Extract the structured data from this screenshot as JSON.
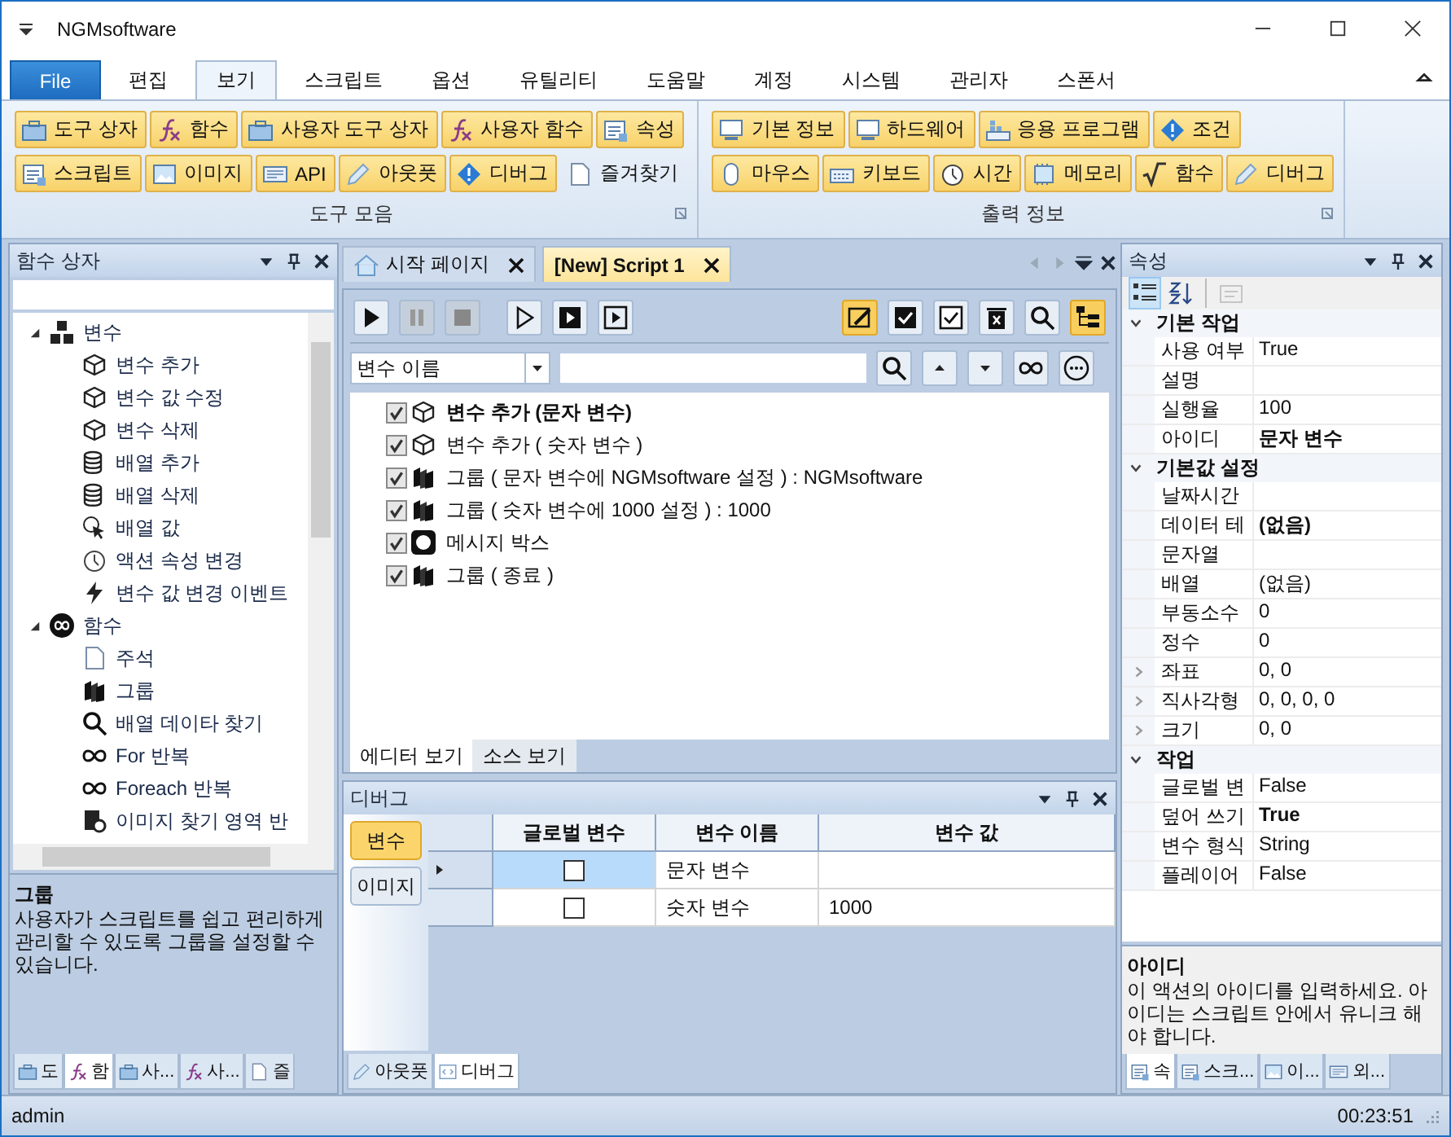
{
  "window": {
    "title": "NGMsoftware"
  },
  "file_button": "File",
  "menu_tabs": [
    {
      "label": "편집",
      "selected": false
    },
    {
      "label": "보기",
      "selected": true
    },
    {
      "label": "스크립트",
      "selected": false
    },
    {
      "label": "옵션",
      "selected": false
    },
    {
      "label": "유틸리티",
      "selected": false
    },
    {
      "label": "도움말",
      "selected": false
    },
    {
      "label": "계정",
      "selected": false
    },
    {
      "label": "시스템",
      "selected": false
    },
    {
      "label": "관리자",
      "selected": false
    },
    {
      "label": "스폰서",
      "selected": false
    }
  ],
  "ribbon_groups": [
    {
      "title": "도구 모음",
      "lines": [
        {
          "buttons": [
            {
              "label": "도구 상자",
              "highlighted": true
            },
            {
              "label": "함수",
              "highlighted": true
            },
            {
              "label": "사용자 도구 상자",
              "highlighted": true
            },
            {
              "label": "사용자 함수",
              "highlighted": true
            },
            {
              "label": "속성",
              "highlighted": true
            }
          ]
        },
        {
          "buttons": [
            {
              "label": "스크립트",
              "highlighted": true
            },
            {
              "label": "이미지",
              "highlighted": true
            },
            {
              "label": "API",
              "highlighted": true
            },
            {
              "label": "아웃풋",
              "highlighted": true
            },
            {
              "label": "디버그",
              "highlighted": true
            },
            {
              "label": "즐겨찾기",
              "highlighted": false
            }
          ]
        }
      ]
    },
    {
      "title": "출력 정보",
      "lines": [
        {
          "buttons": [
            {
              "label": "기본 정보",
              "highlighted": true
            },
            {
              "label": "하드웨어",
              "highlighted": true
            },
            {
              "label": "응용 프로그램",
              "highlighted": true
            },
            {
              "label": "조건",
              "highlighted": true
            }
          ]
        },
        {
          "buttons": [
            {
              "label": "마우스",
              "highlighted": true
            },
            {
              "label": "키보드",
              "highlighted": true
            },
            {
              "label": "시간",
              "highlighted": true
            },
            {
              "label": "메모리",
              "highlighted": true
            },
            {
              "label": "함수",
              "highlighted": true
            },
            {
              "label": "디버그",
              "highlighted": true
            }
          ]
        }
      ]
    }
  ],
  "toolbox": {
    "title": "함수 상자",
    "tree": [
      {
        "label": "변수",
        "expanded": true,
        "children": [
          {
            "label": "변수 추가"
          },
          {
            "label": "변수 값 수정"
          },
          {
            "label": "변수 삭제"
          },
          {
            "label": "배열 추가"
          },
          {
            "label": "배열 삭제"
          },
          {
            "label": "배열 값"
          },
          {
            "label": "액션 속성 변경"
          },
          {
            "label": "변수 값 변경 이벤트"
          }
        ]
      },
      {
        "label": "함수",
        "expanded": true,
        "children": [
          {
            "label": "주석"
          },
          {
            "label": "그룹"
          },
          {
            "label": "배열 데이타 찾기"
          },
          {
            "label": "For 반복"
          },
          {
            "label": "Foreach 반복"
          },
          {
            "label": "이미지 찾기 영역 반"
          }
        ]
      }
    ],
    "description": {
      "title": "그룹",
      "text": "사용자가 스크립트를 쉽고 편리하게 관리할 수 있도록 그룹을 설정할 수 있습니다."
    },
    "bottom_tabs": [
      {
        "label": "도",
        "selected": false
      },
      {
        "label": "함",
        "selected": true
      },
      {
        "label": "사...",
        "selected": false
      },
      {
        "label": "사...",
        "selected": false
      },
      {
        "label": "즐",
        "selected": false
      }
    ]
  },
  "document_tabs": [
    {
      "label": "시작 페이지",
      "selected": false
    },
    {
      "label": "[New] Script 1",
      "selected": true
    }
  ],
  "playback_buttons": [
    {
      "disabled": false
    },
    {
      "disabled": true
    },
    {
      "disabled": true
    },
    {
      "disabled": false
    },
    {
      "disabled": false
    },
    {
      "disabled": false
    }
  ],
  "view_buttons": [
    {
      "active": true
    },
    {
      "active": false
    },
    {
      "active": false
    },
    {
      "active": false
    },
    {
      "active": false
    },
    {
      "active": true
    }
  ],
  "search": {
    "field_select": "변수 이름"
  },
  "script_items": [
    {
      "label": "변수 추가 (문자 변수)",
      "checked": true,
      "bold": true
    },
    {
      "label": "변수 추가 ( 숫자 변수 )",
      "checked": true,
      "bold": false
    },
    {
      "label": "그룹 ( 문자 변수에 NGMsoftware 설정 ) : NGMsoftware",
      "checked": true,
      "bold": false
    },
    {
      "label": "그룹 ( 숫자 변수에 1000 설정 ) : 1000",
      "checked": true,
      "bold": false
    },
    {
      "label": "메시지 박스",
      "checked": true,
      "bold": false
    },
    {
      "label": "그룹 ( 종료 )",
      "checked": true,
      "bold": false
    }
  ],
  "editor_views": [
    {
      "label": "에디터 보기",
      "selected": true
    },
    {
      "label": "소스 보기",
      "selected": false
    }
  ],
  "debug": {
    "title": "디버그",
    "side_buttons": [
      {
        "label": "변수",
        "selected": true
      },
      {
        "label": "이미지",
        "selected": false
      }
    ],
    "columns": [
      "글로벌 변수",
      "변수 이름",
      "변수 값"
    ],
    "rows": [
      {
        "global": false,
        "name": "문자 변수",
        "current": true
      },
      {
        "global": false,
        "name": "숫자 변수",
        "value": "1000",
        "current": false
      }
    ],
    "bottom_tabs": [
      {
        "label": "아웃풋",
        "selected": false
      },
      {
        "label": "디버그",
        "selected": true
      }
    ]
  },
  "properties": {
    "title": "속성",
    "categories": [
      {
        "name": "기본 작업",
        "expanded": true,
        "props": [
          {
            "name": "사용 여부",
            "value": "True",
            "expandable": false
          },
          {
            "name": "설명",
            "expandable": false
          },
          {
            "name": "실행율",
            "value": "100",
            "expandable": false
          },
          {
            "name": "아이디",
            "value": "문자 변수",
            "bold": true,
            "expandable": false
          }
        ]
      },
      {
        "name": "기본값 설정",
        "expanded": true,
        "props": [
          {
            "name": "날짜시간",
            "expandable": false
          },
          {
            "name": "데이터 테",
            "value": "(없음)",
            "bold": true,
            "expandable": false
          },
          {
            "name": "문자열",
            "expandable": false
          },
          {
            "name": "배열",
            "value": "(없음)",
            "expandable": false
          },
          {
            "name": "부동소수",
            "value": "0",
            "expandable": false
          },
          {
            "name": "정수",
            "value": "0",
            "expandable": false
          },
          {
            "name": "좌표",
            "value": "0, 0",
            "expandable": true
          },
          {
            "name": "직사각형",
            "value": "0, 0, 0, 0",
            "expandable": true
          },
          {
            "name": "크기",
            "value": "0, 0",
            "expandable": true
          }
        ]
      },
      {
        "name": "작업",
        "expanded": true,
        "props": [
          {
            "name": "글로벌 변",
            "value": "False",
            "expandable": false
          },
          {
            "name": "덮어 쓰기",
            "value": "True",
            "bold": true,
            "expandable": false
          },
          {
            "name": "변수 형식",
            "value": "String",
            "expandable": false
          },
          {
            "name": "플레이어",
            "value": "False",
            "expandable": false
          }
        ]
      }
    ],
    "description": {
      "title": "아이디",
      "text": "이 액션의 아이디를 입력하세요. 아이디는 스크립트 안에서 유니크 해야 합니다."
    },
    "bottom_tabs": [
      {
        "label": "속",
        "selected": true
      },
      {
        "label": "스크...",
        "selected": false
      },
      {
        "label": "이...",
        "selected": false
      },
      {
        "label": "외...",
        "selected": false
      }
    ]
  },
  "status_bar": {
    "user": "admin",
    "time": "00:23:51"
  }
}
